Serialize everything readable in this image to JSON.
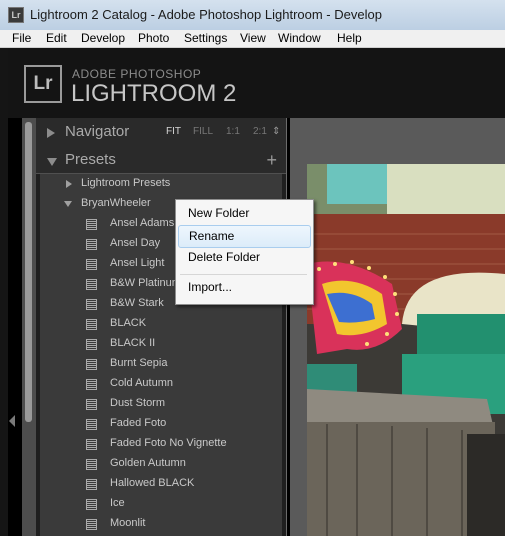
{
  "window": {
    "title": "Lightroom 2 Catalog - Adobe Photoshop Lightroom - Develop",
    "icon": "lightroom-app-icon",
    "icon_text": "Lr"
  },
  "menu": [
    "File",
    "Edit",
    "Develop",
    "Photo",
    "Settings",
    "View",
    "Window",
    "Help"
  ],
  "brand": {
    "badge": "Lr",
    "line1": "ADOBE PHOTOSHOP",
    "line2": "LIGHTROOM 2"
  },
  "navigator": {
    "label": "Navigator",
    "zoom": [
      "FIT",
      "FILL",
      "1:1",
      "2:1"
    ],
    "zoom_stepper": "⇕",
    "selected": "FIT"
  },
  "presets": {
    "label": "Presets",
    "add": "+",
    "folders": [
      {
        "label": "Lightroom Presets"
      },
      {
        "label": "BryanWheeler"
      }
    ],
    "items": [
      "Ansel Adams",
      "Ansel Day",
      "Ansel Light",
      "B&W Platinum",
      "B&W Stark",
      "BLACK",
      "BLACK II",
      "Burnt Sepia",
      "Cold Autumn",
      "Dust Storm",
      "Faded Foto",
      "Faded Foto No Vignette",
      "Golden Autumn",
      "Hallowed BLACK",
      "Ice",
      "Moonlit"
    ]
  },
  "context_menu": {
    "items": [
      "New Folder",
      "Rename",
      "Delete Folder",
      "Import..."
    ],
    "highlighted": "Rename"
  },
  "colors": {
    "panel_bg": "#3a3a3a",
    "menu_highlight": "#dcecf9"
  }
}
